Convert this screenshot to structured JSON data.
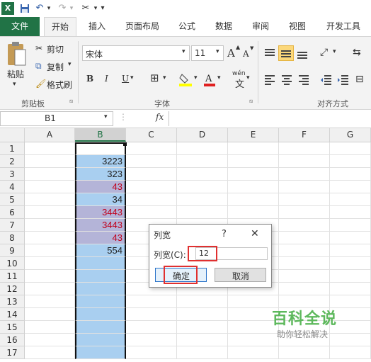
{
  "quick_access": {
    "overflow_glyph": "▾"
  },
  "tabs": [
    "文件",
    "开始",
    "插入",
    "页面布局",
    "公式",
    "数据",
    "审阅",
    "视图",
    "开发工具"
  ],
  "ribbon": {
    "clipboard": {
      "paste": "粘贴",
      "cut": "剪切",
      "copy": "复制",
      "format_painter": "格式刷",
      "group_label": "剪贴板"
    },
    "font": {
      "font_name": "宋体",
      "font_size": "11",
      "grow": "A",
      "shrink": "A",
      "bold": "B",
      "italic": "I",
      "underline": "U",
      "phonetic": "wén",
      "group_label": "字体"
    },
    "alignment": {
      "group_label": "对齐方式"
    }
  },
  "formula_bar": {
    "name_box": "B1",
    "fx": "fx",
    "value": ""
  },
  "columns": [
    "A",
    "B",
    "C",
    "D",
    "E",
    "F",
    "G"
  ],
  "rows": [
    "1",
    "2",
    "3",
    "4",
    "5",
    "6",
    "7",
    "8",
    "9",
    "10",
    "11",
    "12",
    "13",
    "14",
    "15",
    "16",
    "17"
  ],
  "column_b_values": [
    "",
    "3223",
    "323",
    "43",
    "34",
    "3443",
    "3443",
    "43",
    "554",
    "",
    "",
    "",
    "",
    "",
    "",
    "",
    ""
  ],
  "dialog": {
    "title": "列宽",
    "help": "?",
    "close": "✕",
    "field_label": "列宽(C):",
    "field_value": "12",
    "ok": "确定",
    "cancel": "取消"
  },
  "watermark": {
    "title": "百科全说",
    "subtitle": "助你轻松解决"
  },
  "colors": {
    "accent": "#217346",
    "selection": "#a9cff0",
    "highlight": "#b4b4d8",
    "red_text": "#c0001c",
    "annotation": "#e03030"
  }
}
